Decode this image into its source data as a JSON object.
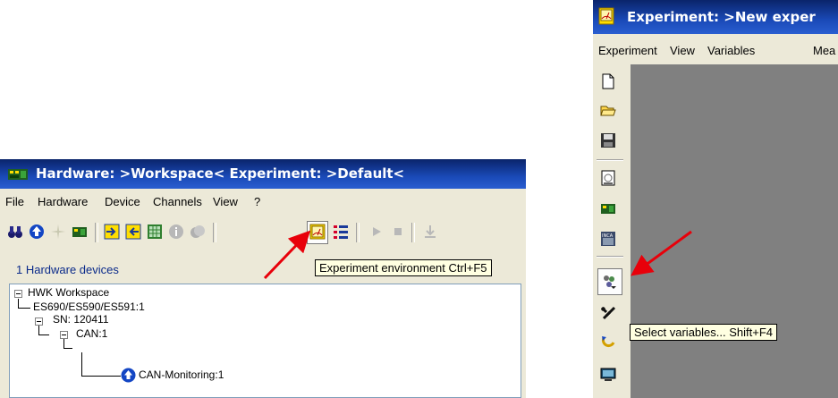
{
  "hardware_window": {
    "title": "Hardware: >Workspace<   Experiment: >Default<",
    "menu": [
      "File",
      "Hardware",
      "Device",
      "Channels",
      "View",
      "?"
    ],
    "toolbar_icons": [
      "binoculars-icon",
      "upload-icon",
      "sparkle-icon",
      "hardware-icon",
      "import-icon",
      "export-icon",
      "grid-icon",
      "info-icon",
      "device-icon",
      "experiment-environment-icon",
      "list-icon",
      "play-icon",
      "stop-icon",
      "download-icon"
    ],
    "tooltip": "Experiment environment  Ctrl+F5",
    "device_count": "1 Hardware devices",
    "tree": [
      "HWK Workspace",
      "ES690/ES590/ES591:1",
      "SN: 120411",
      "CAN:1",
      "CAN-Monitoring:1"
    ]
  },
  "experiment_window": {
    "title": "Experiment: >New exper",
    "menu": [
      "Experiment",
      "View",
      "Variables",
      "Mea"
    ],
    "vertical_toolbar_icons": [
      "new-document-icon",
      "open-folder-icon",
      "save-icon",
      "calibration-icon",
      "hardware-icon",
      "inca-icon",
      "select-variables-icon",
      "tools-icon",
      "refresh-icon",
      "monitor-icon"
    ],
    "tooltip": "Select variables...  Shift+F4"
  },
  "colors": {
    "titlebar": "#0a246a",
    "arrow": "#e8000a",
    "tooltip_bg": "#ffffe1",
    "canvas": "#808080"
  }
}
